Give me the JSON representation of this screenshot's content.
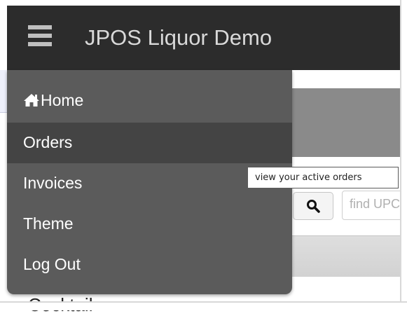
{
  "app": {
    "title": "JPOS Liquor Demo"
  },
  "icons": {
    "menu": "hamburger-icon",
    "home": "home-icon",
    "search": "search-icon"
  },
  "menu": {
    "items": [
      {
        "label": "Home",
        "icon": "home-icon"
      },
      {
        "label": "Orders",
        "active": true
      },
      {
        "label": "Invoices"
      },
      {
        "label": "Theme"
      },
      {
        "label": "Log Out"
      }
    ]
  },
  "tooltip": {
    "text": "view your active orders"
  },
  "search": {
    "placeholder": "find UPC"
  },
  "section": {
    "partial_heading": "Cocktail"
  },
  "colors": {
    "topbar": "#2c2c2c",
    "menu_bg": "#5b5b5b",
    "menu_active": "#444444",
    "header_band": "#8a8a8a"
  }
}
